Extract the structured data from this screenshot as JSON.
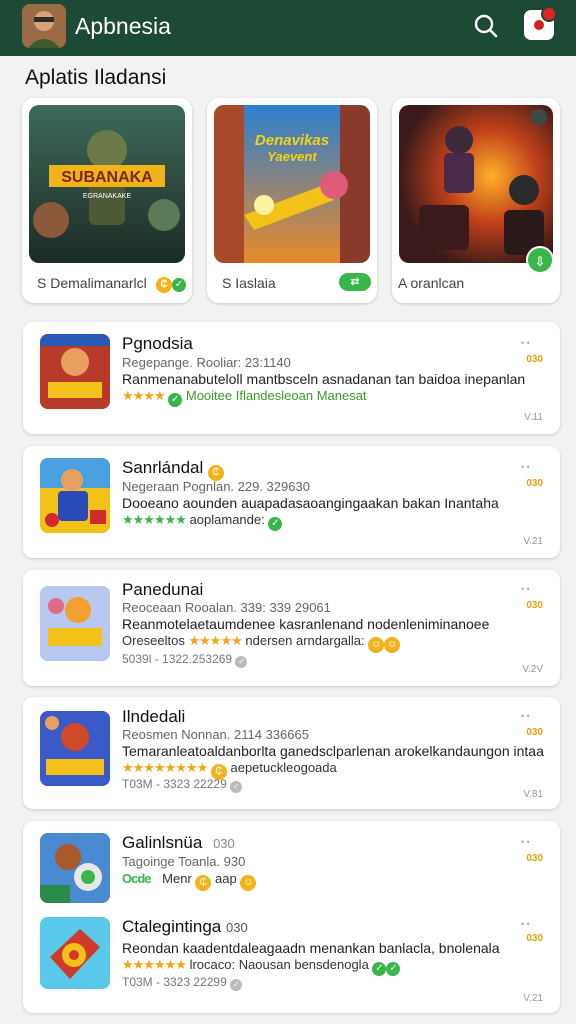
{
  "app": {
    "title": "Apbnesia"
  },
  "section": {
    "title": "Aplatis Iladansi"
  },
  "featured": [
    {
      "label": "S Demalimanarlcl",
      "art_title": "SUBANAKA",
      "art_sub": "EGRANAKAKE"
    },
    {
      "label": "S Iaslaia",
      "art_title": "Denavikas",
      "art_sub": "Yaevent"
    },
    {
      "label": "A oranlcan",
      "art_title": "",
      "art_sub": ""
    }
  ],
  "items": [
    {
      "name": "Pgnodsia",
      "sub": "Regepange. Rooliar: 23:1140",
      "desc": "Ranmenanabuteloll mantbsceln asnadanan  tan baidoa inepanlan",
      "stars": "★★★★",
      "tag": "Mooitee Iflandesleoan Manesat",
      "ver": "V.11",
      "num": "030"
    },
    {
      "name": "Sanrlándal",
      "sub": "Negeraan Pognlan. 229. 329630",
      "desc": "Dooeano aounden auapadasaoangingaakan bakan Inantaha",
      "stars": "★★★★★★",
      "tag": "aoplamande:",
      "ver": "V.21",
      "num": "030"
    },
    {
      "name": "Panedunai",
      "sub": "Reoceaan Rooalan. 339: 339 29061",
      "desc": "Reanmotelaetaumdenee kasranlenand nodenleniminanoee",
      "extra": "Oreseeltos",
      "stars": "★★★★★",
      "tag": "ndersen arndargalla:",
      "meta": "5039l - 1322.253269",
      "ver": "V.2V",
      "num": "030"
    },
    {
      "name": "Ilndedali",
      "sub": "Reosmen Nonnan. 2114 336665",
      "desc": "Temaranleatoaldanborlta ganedsclparlenan arokelkandaungon intaa",
      "stars": "★★★★★★★★",
      "tag": "aepetuckleogoada",
      "meta": "T03M - 3323 22229",
      "ver": "V.81",
      "num": "030"
    },
    {
      "name": "Galinlsnüa",
      "name_num": "030",
      "sub": "Tagoinge Toanla. 930",
      "desc": "",
      "stars": "Ocde",
      "tag": "Menr",
      "extra": "aap",
      "ver": "",
      "num": "030"
    },
    {
      "name": "Ctalegintinga",
      "name_num": "030",
      "sub": "",
      "desc": "Reondan kaadentdaleagaadn menankan banlacla, bnolenala",
      "stars": "★★★★★★",
      "tag": "lrocaco: Naousan bensdenogla",
      "meta": "T03M - 3323 22299",
      "ver": "V.21",
      "num": "030"
    }
  ],
  "colors": {
    "topbar": "#1d4a35",
    "accent_orange": "#f2a516",
    "accent_green": "#39b54a",
    "notification": "#e02424"
  }
}
